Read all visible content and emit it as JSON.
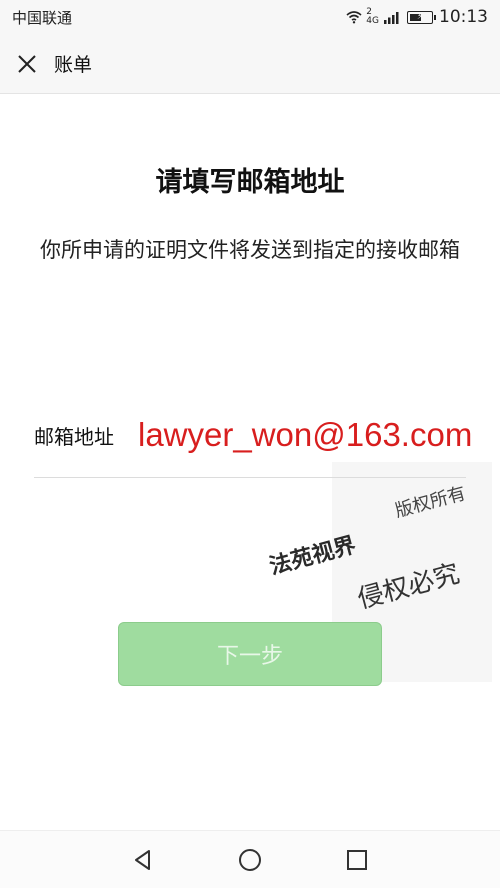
{
  "status_bar": {
    "carrier": "中国联通",
    "network_top": "2",
    "network_gen": "4G",
    "time": "10:13",
    "battery_level": 0.55
  },
  "header": {
    "title": "账单",
    "close_icon": "close-icon"
  },
  "main": {
    "heading": "请填写邮箱地址",
    "description": "你所申请的证明文件将发送到指定的接收邮箱",
    "email_label": "邮箱地址",
    "email_value": "lawyer_won@163.com",
    "next_button": "下一步"
  },
  "watermark": {
    "line1": "版权所有",
    "line2": "法苑视界",
    "line3": "侵权必究"
  },
  "nav": {
    "back_icon": "back-triangle-icon",
    "home_icon": "home-circle-icon",
    "recents_icon": "recents-square-icon"
  },
  "colors": {
    "email_text": "#d81e1e",
    "button_bg": "#9fdc9f",
    "button_text": "#e8f7e8"
  }
}
